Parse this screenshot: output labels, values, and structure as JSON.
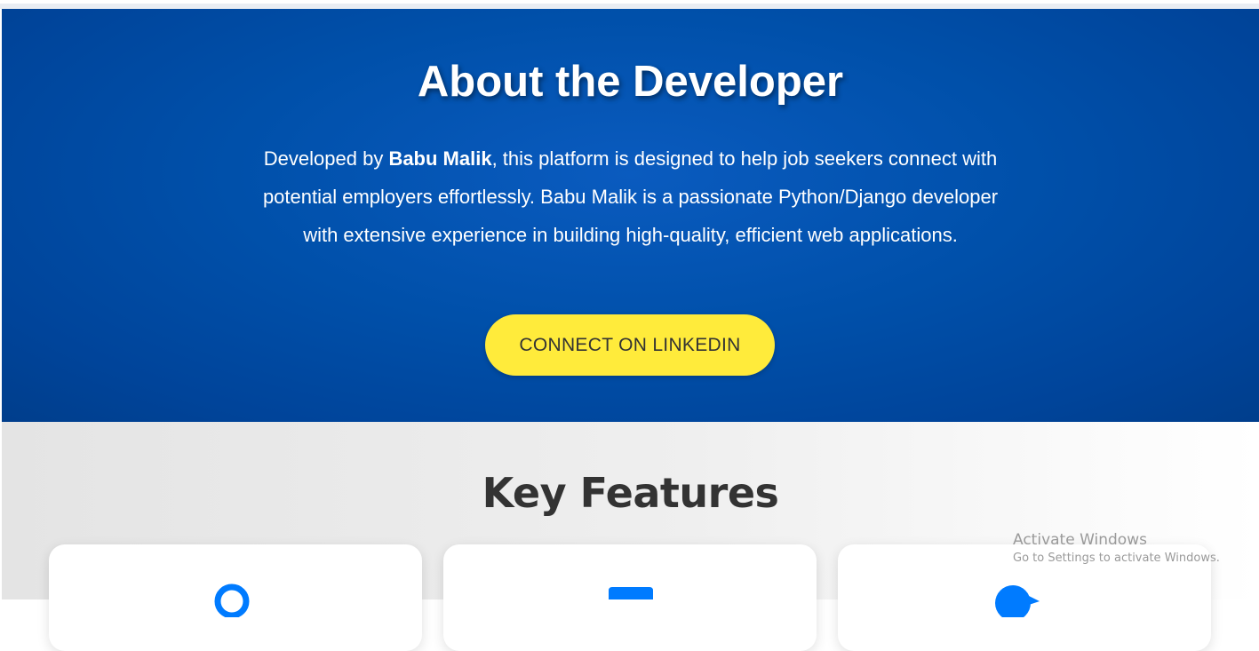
{
  "about": {
    "title": "About the Developer",
    "desc_prefix": "Developed by ",
    "desc_name": "Babu Malik",
    "desc_rest": ", this platform is designed to help job seekers connect with potential employers effortlessly. Babu Malik is a passionate Python/Django developer with extensive experience in building high-quality, efficient web applications.",
    "cta_label": "CONNECT ON LINKEDIN"
  },
  "features": {
    "title": "Key Features",
    "cards": [
      {
        "icon": "search-icon"
      },
      {
        "icon": "briefcase-icon"
      },
      {
        "icon": "user-icon"
      }
    ]
  },
  "watermark": {
    "line1": "Activate Windows",
    "line2": "Go to Settings to activate Windows."
  },
  "colors": {
    "primary_blue": "#0050aa",
    "accent_yellow": "#ffeb3b",
    "icon_blue": "#007bff",
    "heading_dark": "#333333"
  }
}
